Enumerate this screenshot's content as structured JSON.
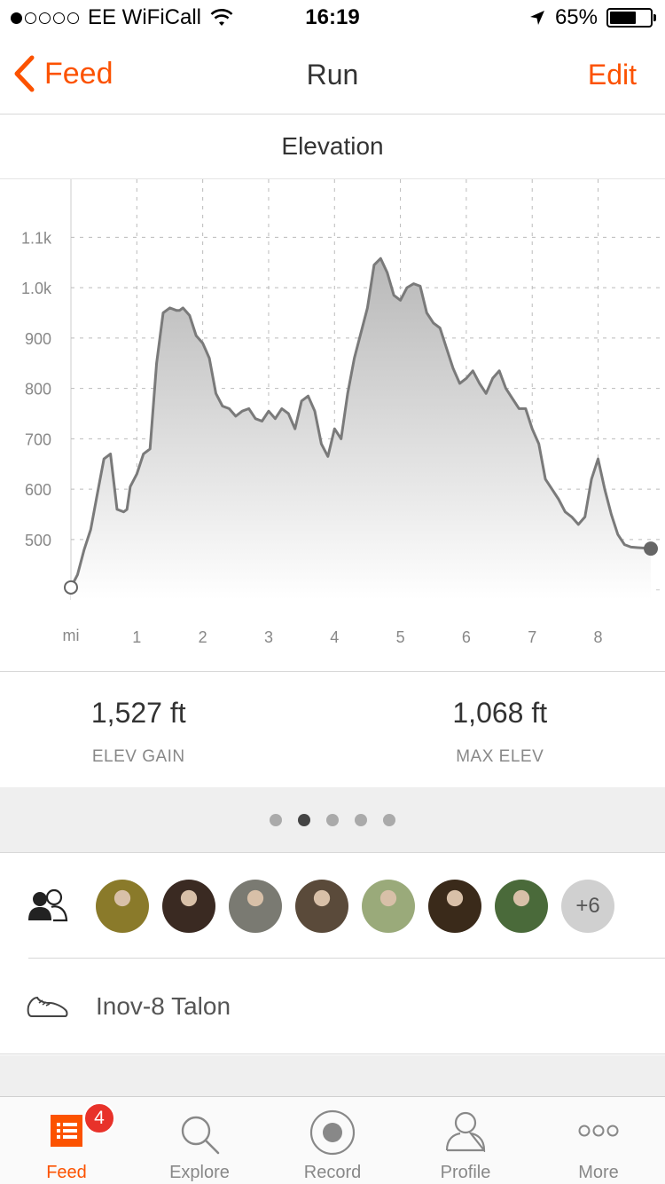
{
  "status_bar": {
    "carrier": "EE WiFiCall",
    "time": "16:19",
    "battery": "65%",
    "signal_dots_filled": 1,
    "battery_level": 0.65
  },
  "nav": {
    "back_label": "Feed",
    "title": "Run",
    "edit_label": "Edit"
  },
  "section": {
    "title": "Elevation"
  },
  "chart_data": {
    "type": "area",
    "x_unit_label": "mi",
    "x_ticks": [
      "1",
      "2",
      "3",
      "4",
      "5",
      "6",
      "7",
      "8"
    ],
    "y_ticks": [
      "1.1k",
      "1.0k",
      "900",
      "800",
      "700",
      "600",
      "500"
    ],
    "xlim": [
      0,
      8.8
    ],
    "ylim": [
      380,
      1180
    ],
    "x": [
      0,
      0.1,
      0.2,
      0.3,
      0.4,
      0.5,
      0.6,
      0.7,
      0.8,
      0.85,
      0.9,
      1.0,
      1.1,
      1.2,
      1.3,
      1.4,
      1.5,
      1.6,
      1.65,
      1.7,
      1.8,
      1.9,
      2.0,
      2.05,
      2.1,
      2.2,
      2.3,
      2.4,
      2.5,
      2.6,
      2.7,
      2.8,
      2.9,
      3.0,
      3.1,
      3.2,
      3.3,
      3.4,
      3.5,
      3.6,
      3.7,
      3.8,
      3.9,
      4.0,
      4.1,
      4.2,
      4.3,
      4.4,
      4.5,
      4.6,
      4.7,
      4.8,
      4.9,
      5.0,
      5.1,
      5.2,
      5.3,
      5.4,
      5.5,
      5.6,
      5.7,
      5.8,
      5.9,
      6.0,
      6.1,
      6.2,
      6.3,
      6.4,
      6.5,
      6.6,
      6.7,
      6.8,
      6.9,
      7.0,
      7.1,
      7.2,
      7.3,
      7.4,
      7.5,
      7.6,
      7.7,
      7.8,
      7.9,
      8.0,
      8.1,
      8.2,
      8.3,
      8.4,
      8.5,
      8.6,
      8.7,
      8.8
    ],
    "y": [
      405,
      430,
      480,
      520,
      590,
      660,
      670,
      560,
      555,
      560,
      605,
      630,
      670,
      680,
      850,
      950,
      960,
      955,
      955,
      960,
      945,
      905,
      890,
      875,
      860,
      790,
      765,
      760,
      745,
      755,
      760,
      740,
      735,
      755,
      740,
      760,
      750,
      720,
      775,
      785,
      755,
      690,
      665,
      720,
      700,
      790,
      860,
      910,
      960,
      1045,
      1058,
      1030,
      985,
      975,
      1000,
      1008,
      1003,
      950,
      930,
      920,
      880,
      840,
      810,
      820,
      835,
      810,
      790,
      820,
      835,
      800,
      780,
      760,
      760,
      720,
      690,
      620,
      600,
      580,
      555,
      545,
      530,
      545,
      620,
      660,
      600,
      550,
      510,
      490,
      485,
      484,
      483,
      482
    ],
    "grid": true
  },
  "stats": [
    {
      "value": "1,527 ft",
      "label": "ELEV GAIN"
    },
    {
      "value": "1,068 ft",
      "label": "MAX ELEV"
    }
  ],
  "pager": {
    "count": 5,
    "active_index": 1
  },
  "athletes": {
    "more_label": "+6",
    "avatar_colors": [
      "#8a7a2a",
      "#3a2a22",
      "#7a7a72",
      "#5a4a3a",
      "#9aaa7a",
      "#3a2a1a",
      "#4a6a3a"
    ]
  },
  "gear": {
    "name": "Inov-8 Talon"
  },
  "tabbar": {
    "items": [
      {
        "label": "Feed",
        "badge": "4",
        "active": true
      },
      {
        "label": "Explore"
      },
      {
        "label": "Record"
      },
      {
        "label": "Profile"
      },
      {
        "label": "More"
      }
    ]
  },
  "colors": {
    "accent": "#fc5200",
    "badge": "#e8322a"
  }
}
